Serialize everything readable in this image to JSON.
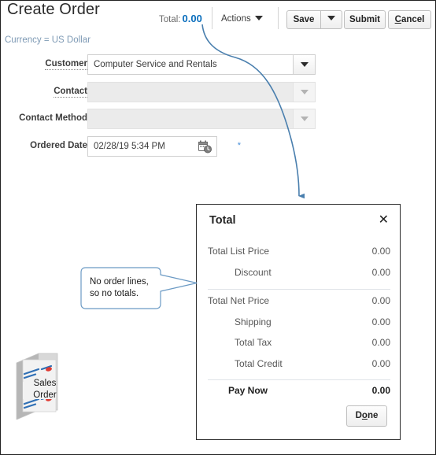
{
  "header": {
    "page_title": "Create Order",
    "total_label": "Total:",
    "total_value": "0.00",
    "actions_label": "Actions",
    "save_label": "Save",
    "submit_label": "Submit",
    "cancel_label": "Cancel",
    "cancel_accel": "C",
    "currency_note": "Currency = US Dollar",
    "accent_blue": "#0a6ebd",
    "note_blue": "#7e9ab5"
  },
  "form": {
    "fields": [
      {
        "label": "Customer",
        "value": "Computer Service and Rentals",
        "placeholder": "",
        "required": false,
        "readonly": false,
        "dropdown_enabled": true
      },
      {
        "label": "Contact",
        "value": "",
        "placeholder": "",
        "required": false,
        "readonly": true,
        "dropdown_enabled": false
      },
      {
        "label": "Contact Method",
        "value": "",
        "placeholder": "",
        "required": false,
        "readonly": true,
        "dropdown_enabled": false
      }
    ],
    "ordered_date": {
      "label": "Ordered Date",
      "value": "02/28/19 5:34 PM",
      "required": true,
      "required_marker": "*",
      "icon": "calendar-clock-icon"
    }
  },
  "total_panel": {
    "title": "Total",
    "close_label": "✕",
    "rows": [
      {
        "label": "Total List Price",
        "value": "0.00",
        "indent": false,
        "bold": false
      },
      {
        "label": "Discount",
        "value": "0.00",
        "indent": true,
        "bold": false
      },
      {
        "label": "Total Net Price",
        "value": "0.00",
        "indent": false,
        "bold": false
      },
      {
        "label": "Shipping",
        "value": "0.00",
        "indent": true,
        "bold": false
      },
      {
        "label": "Total Tax",
        "value": "0.00",
        "indent": true,
        "bold": false
      },
      {
        "label": "Total Credit",
        "value": "0.00",
        "indent": true,
        "bold": false
      },
      {
        "label": "Pay Now",
        "value": "0.00",
        "indent": true,
        "bold": true
      }
    ],
    "done_label": "Done",
    "done_accel": "o"
  },
  "annotations": {
    "callout_text": "No order lines,\nso no totals.",
    "callout_border": "#6b9ac4",
    "arrow_color": "#4a7fae"
  },
  "sales_order_icon": {
    "label": "Sales\nOrder",
    "icon": "sales-order-document-icon"
  }
}
